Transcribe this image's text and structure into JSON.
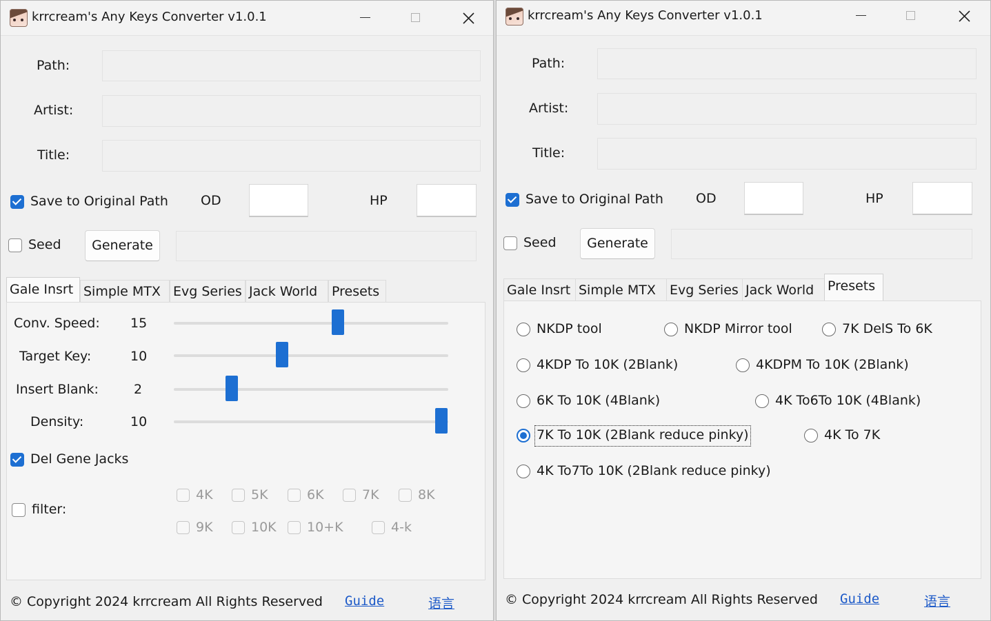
{
  "window_title": "krrcream's Any Keys Converter v1.0.1",
  "fields": {
    "path_label": "Path:",
    "artist_label": "Artist:",
    "title_label": "Title:"
  },
  "save_to_original_path": {
    "label": "Save to Original Path",
    "checked": true
  },
  "od_label": "OD",
  "hp_label": "HP",
  "seed": {
    "label": "Seed",
    "checked": false
  },
  "generate_label": "Generate",
  "tabs": [
    "Gale Insrt",
    "Simple MTX",
    "Evg Series",
    "Jack World",
    "Presets"
  ],
  "left": {
    "active_tab": "Gale Insrt",
    "sliders": [
      {
        "label": "Conv. Speed:",
        "value": "15"
      },
      {
        "label": "Target Key:",
        "value": "10"
      },
      {
        "label": "Insert Blank:",
        "value": "2"
      },
      {
        "label": "Density:",
        "value": "10"
      }
    ],
    "del_gene_jacks": {
      "label": "Del Gene Jacks",
      "checked": true
    },
    "filter": {
      "label": "filter:",
      "checked": false
    },
    "filter_options": [
      "4K",
      "5K",
      "6K",
      "7K",
      "8K",
      "9K",
      "10K",
      "10+K",
      "4-k"
    ]
  },
  "right": {
    "active_tab": "Presets",
    "presets": [
      {
        "label": "NKDP tool",
        "selected": false
      },
      {
        "label": "NKDP Mirror tool",
        "selected": false
      },
      {
        "label": "7K DelS To 6K",
        "selected": false
      },
      {
        "label": "4KDP To 10K (2Blank)",
        "selected": false
      },
      {
        "label": "4KDPM To 10K (2Blank)",
        "selected": false
      },
      {
        "label": "6K To 10K (4Blank)",
        "selected": false
      },
      {
        "label": "4K To6To 10K (4Blank)",
        "selected": false
      },
      {
        "label": "7K To 10K (2Blank reduce pinky)",
        "selected": true
      },
      {
        "label": "4K To 7K",
        "selected": false
      },
      {
        "label": "4K To7To 10K (2Blank reduce pinky)",
        "selected": false
      }
    ]
  },
  "footer": {
    "copyright": "© Copyright 2024 krrcream All Rights Reserved",
    "guide": "Guide",
    "language": "语言"
  },
  "colors": {
    "accent": "#1d6fd2",
    "link": "#1d5ac8",
    "background": "#f0f0f0"
  }
}
